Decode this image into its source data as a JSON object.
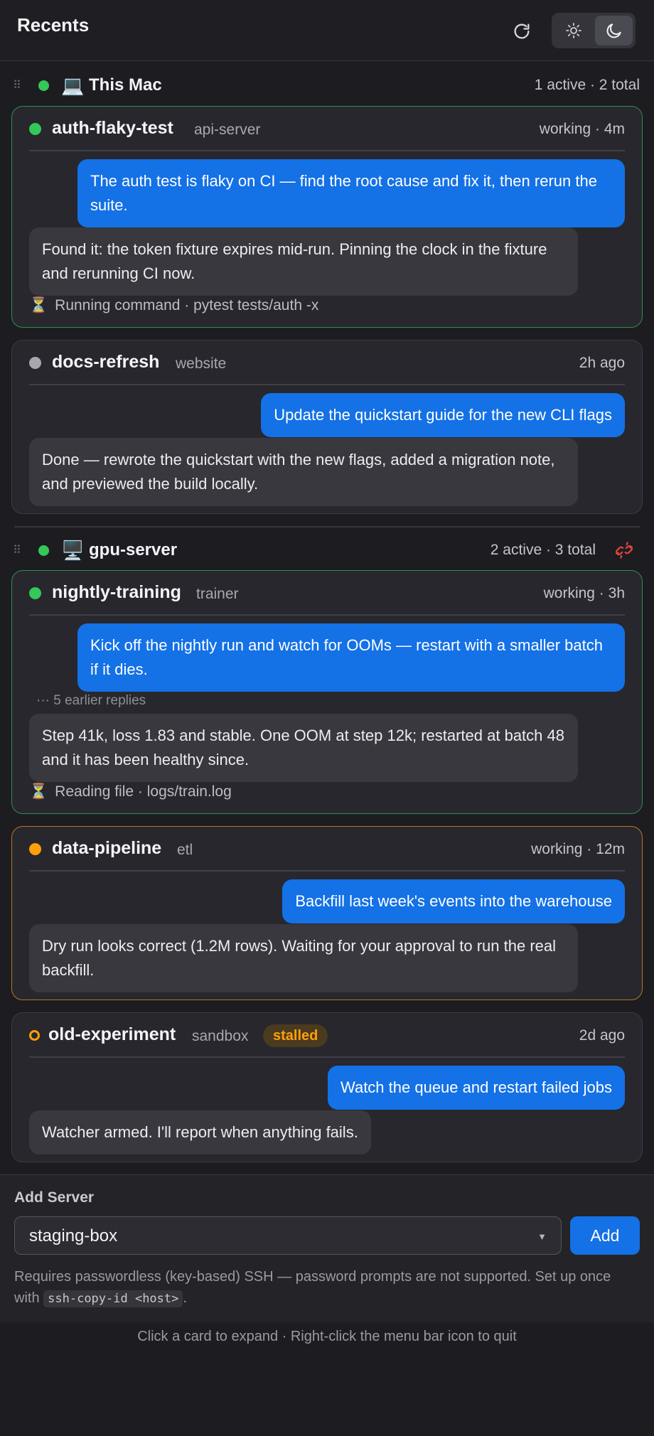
{
  "header": {
    "title": "Recents",
    "refresh_icon": "refresh-icon",
    "theme": {
      "light_icon": "sun-icon",
      "dark_icon": "moon-icon",
      "selected": "dark"
    }
  },
  "groups": [
    {
      "name": "This Mac",
      "icon": "laptop-icon",
      "count": "1 active · 2 total",
      "sessions": [
        {
          "title": "auth-flaky-test",
          "project": "api-server",
          "status": "working · 4m",
          "state": "working",
          "user_message": "The auth test is flaky on CI — find the root cause and fix it, then rerun the suite.",
          "agent_message": "Found it: the token fixture expires mid-run. Pinning the clock in the fixture and rerunning CI now.",
          "activity": "Running command · pytest tests/auth -x"
        },
        {
          "title": "docs-refresh",
          "project": "website",
          "status": "2h ago",
          "state": "idle",
          "user_message": "Update the quickstart guide for the new CLI flags",
          "agent_message": "Done — rewrote the quickstart with the new flags, added a migration note, and previewed the build locally."
        }
      ]
    },
    {
      "name": "gpu-server",
      "icon": "desktop-icon",
      "count": "2 active · 3 total",
      "sessions": [
        {
          "title": "nightly-training",
          "project": "trainer",
          "status": "working · 3h",
          "state": "working",
          "user_message": "Kick off the nightly run and watch for OOMs — restart with a smaller batch if it dies.",
          "earlier_replies": "··· 5 earlier replies",
          "agent_message": "Step 41k, loss 1.83 and stable. One OOM at step 12k; restarted at batch 48 and it has been healthy since.",
          "activity": "Reading file · logs/train.log"
        },
        {
          "title": "data-pipeline",
          "project": "etl",
          "status": "working · 12m",
          "state": "waiting",
          "user_message": "Backfill last week's events into the warehouse",
          "agent_message": "Dry run looks correct (1.2M rows). Waiting for your approval to run the real backfill."
        },
        {
          "title": "old-experiment",
          "project": "sandbox",
          "badge": "stalled",
          "status": "2d ago",
          "state": "stalled",
          "user_message": "Watch the queue and restart failed jobs",
          "agent_message": "Watcher armed. I'll report when anything fails."
        }
      ]
    }
  ],
  "add_server": {
    "title": "Add Server",
    "selected": "staging-box",
    "button": "Add",
    "help_text": "Requires passwordless (key-based) SSH — password prompts are not supported. Set up once with",
    "help_code": "ssh-copy-id <host>",
    "help_tail": "."
  },
  "footer": "Click a card to expand · Right-click the menu bar icon to quit",
  "colors": {
    "accent": "#1471e6",
    "working": "#34c759",
    "waiting": "#ff9f0a",
    "idle": "#a7a7ae",
    "disconnect": "#e0443e"
  }
}
